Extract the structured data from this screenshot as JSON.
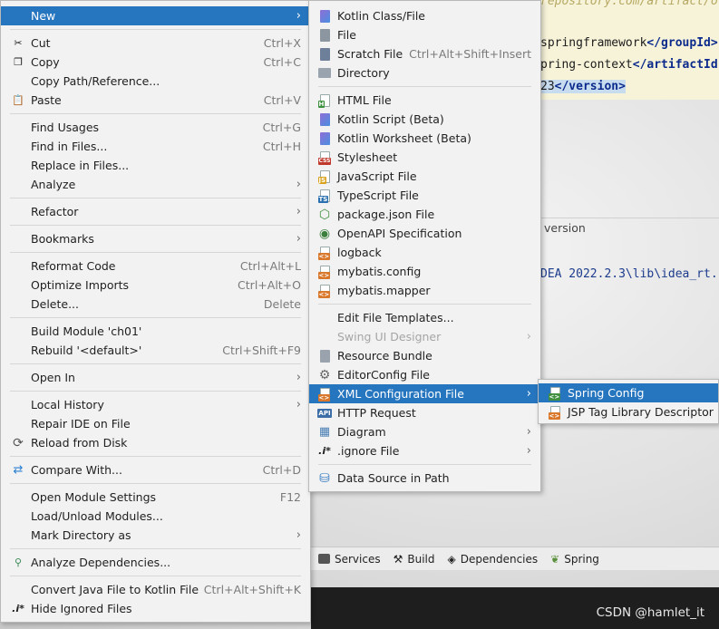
{
  "editor": {
    "line0": "repository.com/artifact/org",
    "line1_text": "springframework",
    "line1_tag": "</groupId>",
    "line2_text": "pring-context",
    "line2_tag": "</artifactId",
    "line3_text": "23",
    "line3_tag": "</version>"
  },
  "version_label": "version",
  "console_line": "DEA 2022.2.3\\lib\\idea_rt.",
  "toolbar": {
    "services": "Services",
    "build": "Build",
    "dependencies": "Dependencies",
    "spring": "Spring"
  },
  "watermark": "CSDN @hamlet_it",
  "main_menu": {
    "new": "New",
    "cut": "Cut",
    "cut_key": "Ctrl+X",
    "copy": "Copy",
    "copy_key": "Ctrl+C",
    "copy_path": "Copy Path/Reference...",
    "paste": "Paste",
    "paste_key": "Ctrl+V",
    "find_usages": "Find Usages",
    "find_usages_key": "Ctrl+G",
    "find_in_files": "Find in Files...",
    "find_in_files_key": "Ctrl+H",
    "replace_in_files": "Replace in Files...",
    "analyze": "Analyze",
    "refactor": "Refactor",
    "bookmarks": "Bookmarks",
    "reformat": "Reformat Code",
    "reformat_key": "Ctrl+Alt+L",
    "optimize": "Optimize Imports",
    "optimize_key": "Ctrl+Alt+O",
    "delete": "Delete...",
    "delete_key": "Delete",
    "build_module": "Build Module 'ch01'",
    "rebuild": "Rebuild '<default>'",
    "rebuild_key": "Ctrl+Shift+F9",
    "open_in": "Open In",
    "local_history": "Local History",
    "repair_ide": "Repair IDE on File",
    "reload": "Reload from Disk",
    "compare": "Compare With...",
    "compare_key": "Ctrl+D",
    "module_settings": "Open Module Settings",
    "module_settings_key": "F12",
    "load_unload": "Load/Unload Modules...",
    "mark_dir": "Mark Directory as",
    "analyze_deps": "Analyze Dependencies...",
    "convert": "Convert Java File to Kotlin File",
    "convert_key": "Ctrl+Alt+Shift+K",
    "hide_ignored": "Hide Ignored Files"
  },
  "new_menu": {
    "kotlin_class": "Kotlin Class/File",
    "file": "File",
    "scratch": "Scratch File",
    "scratch_key": "Ctrl+Alt+Shift+Insert",
    "directory": "Directory",
    "html": "HTML File",
    "kotlin_script": "Kotlin Script (Beta)",
    "kotlin_worksheet": "Kotlin Worksheet (Beta)",
    "stylesheet": "Stylesheet",
    "javascript": "JavaScript File",
    "typescript": "TypeScript File",
    "package_json": "package.json File",
    "openapi": "OpenAPI Specification",
    "logback": "logback",
    "mybatis_config": "mybatis.config",
    "mybatis_mapper": "mybatis.mapper",
    "edit_templates": "Edit File Templates...",
    "swing": "Swing UI Designer",
    "resource_bundle": "Resource Bundle",
    "editorconfig": "EditorConfig File",
    "xml_config": "XML Configuration File",
    "http_request": "HTTP Request",
    "diagram": "Diagram",
    "ignore_file": ".ignore File",
    "data_source": "Data Source in Path"
  },
  "xml_menu": {
    "spring_config": "Spring Config",
    "jsp_tag": "JSP Tag Library Descriptor"
  },
  "colors": {
    "selection": "#2675bf",
    "menu_bg": "#f2f2f2",
    "editor_bg": "#f7f3d9"
  }
}
